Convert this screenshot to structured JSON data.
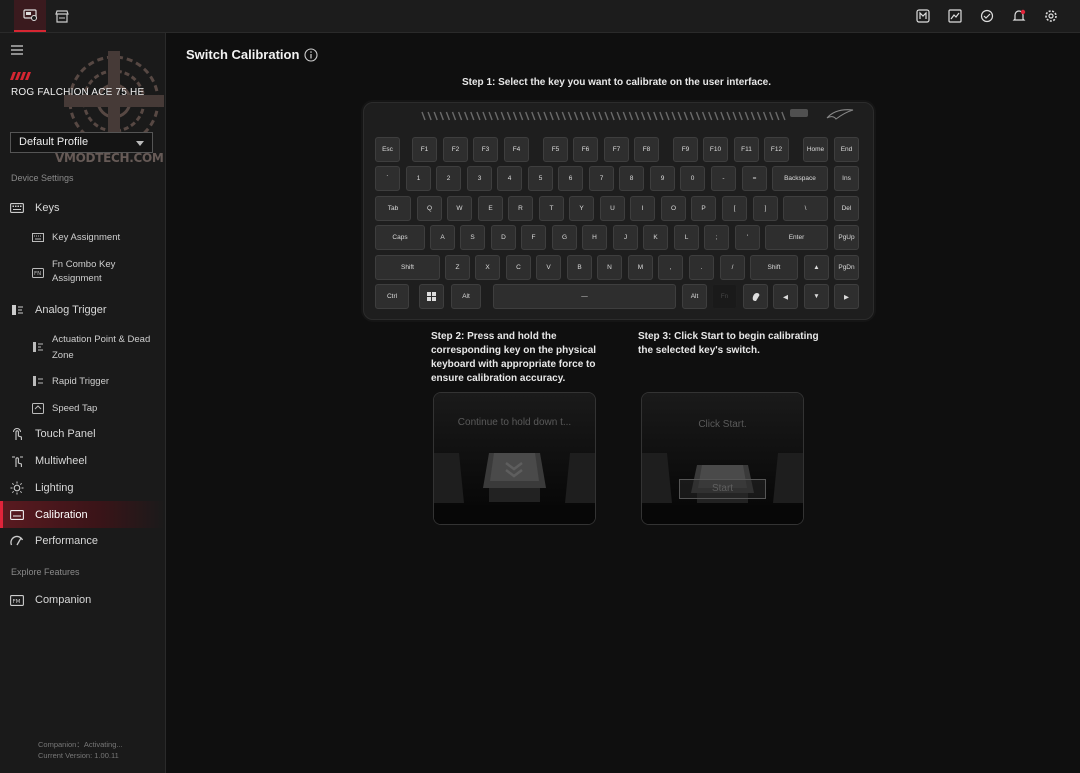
{
  "app": {
    "top_tabs": [
      {
        "icon": "device-icon",
        "active": true
      },
      {
        "icon": "store-icon",
        "active": false
      }
    ],
    "top_actions": [
      "m-badge-icon",
      "gallery-icon",
      "sync-icon",
      "notification-icon",
      "settings-icon"
    ],
    "accent_color": "#d62632"
  },
  "sidebar": {
    "device_name": "ROG FALCHION ACE 75 HE",
    "watermark_text": "VMODTECH.COM",
    "profile": "Default Profile",
    "device_settings_label": "Device Settings",
    "items": [
      {
        "label": "Keys",
        "icon": "keyboard-outline-icon"
      },
      {
        "label": "Key Assignment",
        "icon": "keyboard-icon"
      },
      {
        "label": "Fn Combo Key Assignment",
        "label_line1": "Fn Combo Key",
        "label_line2": "Assignment",
        "icon": "fn-key-icon"
      },
      {
        "label": "Analog Trigger",
        "icon": "analog-trigger-icon"
      },
      {
        "label": "Actuation Point & Dead Zone",
        "label_line1": "Actuation Point & Dead",
        "label_line2": "Zone",
        "icon": "actuation-icon"
      },
      {
        "label": "Rapid Trigger",
        "icon": "rapid-trigger-icon"
      },
      {
        "label": "Speed Tap",
        "icon": "speed-tap-icon"
      },
      {
        "label": "Touch Panel",
        "icon": "touch-panel-icon"
      },
      {
        "label": "Multiwheel",
        "icon": "multiwheel-icon"
      },
      {
        "label": "Lighting",
        "icon": "lighting-icon"
      },
      {
        "label": "Calibration",
        "icon": "calibration-icon",
        "active": true
      },
      {
        "label": "Performance",
        "icon": "performance-icon"
      }
    ],
    "explore_label": "Explore Features",
    "companion": {
      "label": "Companion",
      "icon": "companion-icon"
    },
    "status_line1": "Companion：Activating...",
    "status_line2": "Current Version: 1.00.11"
  },
  "main": {
    "title": "Switch Calibration",
    "step1": "Step 1: Select the key you want to calibrate on the user interface.",
    "step2": "Step 2: Press and hold the corresponding key on the physical keyboard with appropriate force to ensure calibration accuracy.",
    "step3": "Step 3: Click Start to begin calibrating the selected key's switch.",
    "panel1_msg": "Continue to hold down t...",
    "panel2_msg": "Click Start.",
    "start_label": "Start"
  },
  "keyboard": {
    "rows": [
      [
        "Esc",
        "F1",
        "F2",
        "F3",
        "F4",
        "F5",
        "F6",
        "F7",
        "F8",
        "F9",
        "F10",
        "F11",
        "F12",
        "Home",
        "End"
      ],
      [
        "`",
        "1",
        "2",
        "3",
        "4",
        "5",
        "6",
        "7",
        "8",
        "9",
        "0",
        "-",
        "=",
        "Backspace",
        "Ins"
      ],
      [
        "Tab",
        "Q",
        "W",
        "E",
        "R",
        "T",
        "Y",
        "U",
        "I",
        "O",
        "P",
        "[",
        "]",
        "\\",
        "Del"
      ],
      [
        "Caps",
        "A",
        "S",
        "D",
        "F",
        "G",
        "H",
        "J",
        "K",
        "L",
        ";",
        "'",
        "Enter",
        "PgUp"
      ],
      [
        "Shift",
        "Z",
        "X",
        "C",
        "V",
        "B",
        "N",
        "M",
        ",",
        ".",
        "/",
        "Shift",
        "▲",
        "PgDn"
      ],
      [
        "Ctrl",
        "win-icon",
        "Alt",
        "—",
        "Alt",
        "Fn",
        "copilot-icon",
        "◀",
        "▼",
        "▶"
      ]
    ]
  }
}
